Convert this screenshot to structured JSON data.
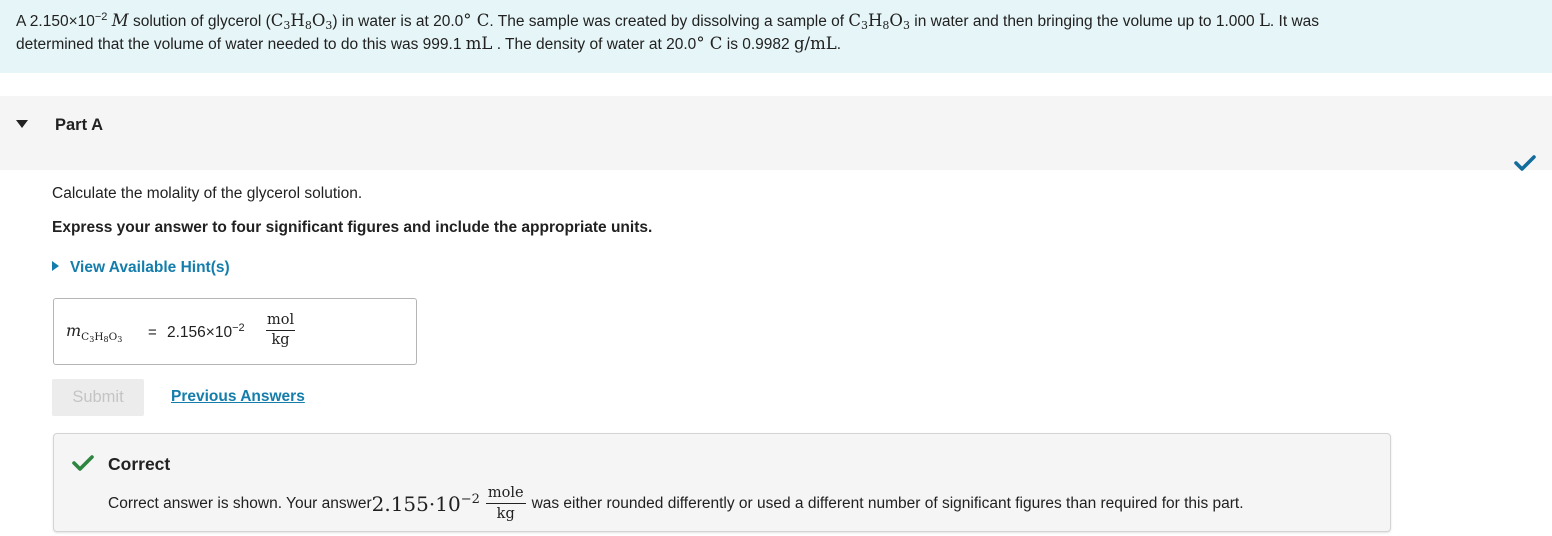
{
  "problem": {
    "p1_a": "A 2.150×10",
    "p1_exp": "−2",
    "p1_M": "M",
    "p1_b": " solution of glycerol (",
    "formula_C": "C",
    "formula_C_sub": "3",
    "formula_H": "H",
    "formula_H_sub": "8",
    "formula_O": "O",
    "formula_O_sub": "3",
    "p1_c": ") in water is at 20.0",
    "deg_C": "° C",
    "p1_d": ". The sample was created by dissolving a sample of ",
    "p1_e": " in water and then bringing the volume up to 1.000 ",
    "unit_L": "L",
    "p1_f": ". It was",
    "p2_a": "determined that the volume of water needed to do this was 999.1 ",
    "unit_mL": "mL",
    "p2_b": " . The density of water at 20.0",
    "p2_c": " is 0.9982 ",
    "unit_density": "g/mL",
    "p2_d": "."
  },
  "part": {
    "title": "Part A",
    "status": "check-icon",
    "accent": "#146c9c"
  },
  "question": {
    "prompt": "Calculate the molality of the glycerol solution.",
    "instruction": "Express your answer to four significant figures and include the appropriate units.",
    "hints_label": "View Available Hint(s)"
  },
  "answer": {
    "var_m": "m",
    "eq": "=",
    "value": "2.156×10",
    "exp": "−2",
    "unit_num": "mol",
    "unit_den": "kg"
  },
  "actions": {
    "submit_label": "Submit",
    "previous_label": "Previous Answers"
  },
  "feedback": {
    "title": "Correct",
    "text_a": "Correct answer is shown. Your answer ",
    "value": "2.155·10",
    "exp": "−2",
    "unit_num": "mole",
    "unit_den": "kg",
    "text_b": "was either rounded differently or used a different number of significant figures than required for this part.",
    "color": "#2e8540"
  }
}
